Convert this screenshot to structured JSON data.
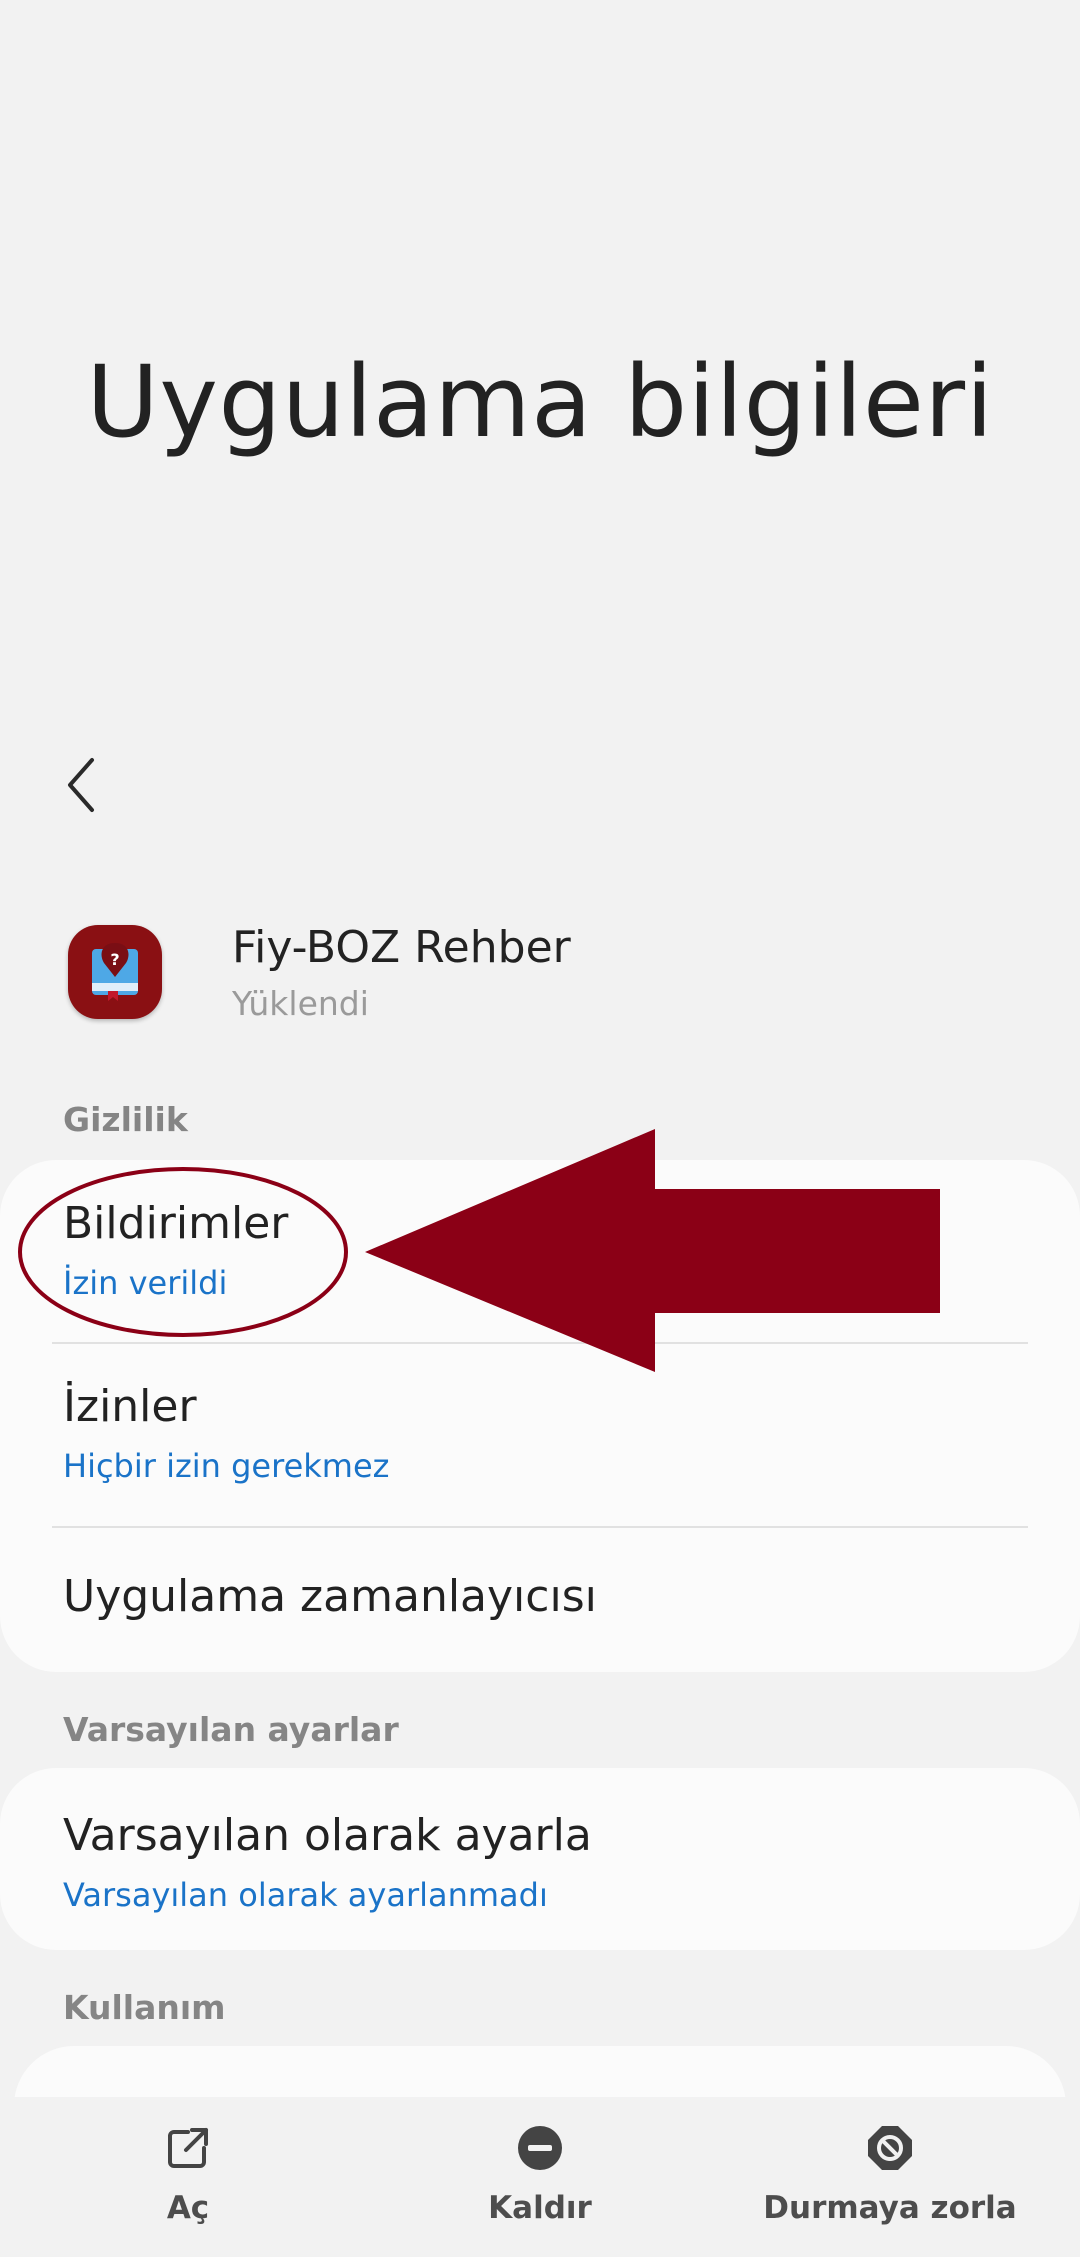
{
  "page_title": "Uygulama bilgileri",
  "app": {
    "name": "Fiy-BOZ Rehber",
    "status": "Yüklendi",
    "icon": "book-question-icon"
  },
  "sections": {
    "privacy": {
      "header": "Gizlilik",
      "items": [
        {
          "title": "Bildirimler",
          "subtitle": "İzin verildi"
        },
        {
          "title": "İzinler",
          "subtitle": "Hiçbir izin gerekmez"
        },
        {
          "title": "Uygulama zamanlayıcısı"
        }
      ]
    },
    "defaults": {
      "header": "Varsayılan ayarlar",
      "items": [
        {
          "title": "Varsayılan olarak ayarla",
          "subtitle": "Varsayılan olarak ayarlanmadı"
        }
      ]
    },
    "usage": {
      "header": "Kullanım"
    }
  },
  "bottom_actions": [
    {
      "label": "Aç",
      "icon": "open-external-icon"
    },
    {
      "label": "Kaldır",
      "icon": "remove-circle-icon"
    },
    {
      "label": "Durmaya zorla",
      "icon": "block-icon"
    }
  ],
  "colors": {
    "background": "#f2f2f2",
    "card": "#fbfbfb",
    "link_blue": "#1a73c8",
    "annotation_red": "#8b0016"
  }
}
